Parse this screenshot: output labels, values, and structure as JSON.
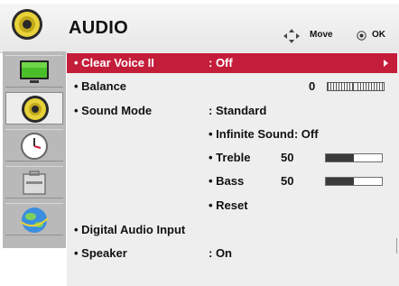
{
  "header": {
    "title": "AUDIO",
    "move_hint": "Move",
    "ok_hint": "OK"
  },
  "sidebar": {
    "items": [
      {
        "icon": "tv-picture-icon",
        "selected": false
      },
      {
        "icon": "speaker-icon",
        "selected": true
      },
      {
        "icon": "clock-icon",
        "selected": false
      },
      {
        "icon": "toolbox-icon",
        "selected": false
      },
      {
        "icon": "globe-icon",
        "selected": false
      }
    ]
  },
  "menu": {
    "clear_voice": {
      "label": "• Clear Voice II",
      "value": ": Off"
    },
    "balance": {
      "label": "• Balance",
      "value": "0",
      "level": 0.5
    },
    "sound_mode": {
      "label": "• Sound Mode",
      "value": ": Standard"
    },
    "infinite_sound": {
      "label": "• Infinite Sound: Off"
    },
    "treble": {
      "label": "• Treble",
      "value": "50",
      "level": 0.5
    },
    "bass": {
      "label": "• Bass",
      "value": "50",
      "level": 0.5
    },
    "reset": {
      "label": "• Reset"
    },
    "digital_audio_input": {
      "label": "• Digital Audio Input"
    },
    "speaker": {
      "label": "• Speaker",
      "value": ": On"
    }
  },
  "colors": {
    "highlight": "#c41d3a",
    "panel": "#eeeeee",
    "sidebar": "#b9b9b9"
  }
}
